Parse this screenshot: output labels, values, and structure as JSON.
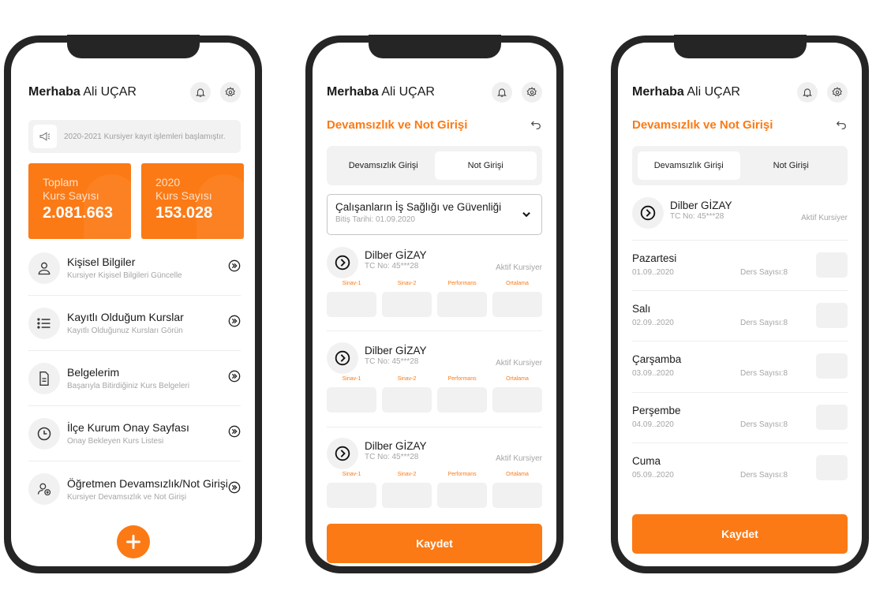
{
  "user": {
    "greeting": "Merhaba",
    "name": "Ali UÇAR"
  },
  "colors": {
    "accent": "#fb7a15",
    "frame": "#252525"
  },
  "screen1": {
    "announcement": "2020-2021 Kursiyer kayıt işlemleri başlamıştır.",
    "stats": [
      {
        "line1": "Toplam",
        "line2": "Kurs Sayısı",
        "value": "2.081.663"
      },
      {
        "line1": "2020",
        "line2": "Kurs Sayısı",
        "value": "153.028"
      }
    ],
    "menu": [
      {
        "icon": "user-icon",
        "title": "Kişisel Bilgiler",
        "subtitle": "Kursiyer Kişisel Bilgileri Güncelle"
      },
      {
        "icon": "list-icon",
        "title": "Kayıtlı Olduğum Kurslar",
        "subtitle": "Kayıtlı Olduğunuz Kursları Görün"
      },
      {
        "icon": "document-icon",
        "title": "Belgelerim",
        "subtitle": "Başarıyla Bitirdiğiniz Kurs Belgeleri"
      },
      {
        "icon": "clock-icon",
        "title": "İlçe Kurum Onay Sayfası",
        "subtitle": "Onay Bekleyen Kurs Listesi"
      },
      {
        "icon": "user-add-icon",
        "title": "Öğretmen Devamsızlık/Not Girişi",
        "subtitle": "Kursiyer Devamsızlık ve Not Girişi"
      }
    ]
  },
  "screen2": {
    "title": "Devamsızlık ve Not Girişi",
    "tabs": [
      "Devamsızlık Girişi",
      "Not Girişi"
    ],
    "active_tab": 1,
    "course": {
      "name": "Çalışanların İş Sağlığı ve Güvenliği",
      "end_date": "Bitiş Tarihi: 01.09.2020"
    },
    "grade_labels": [
      "Sinav-1",
      "Sinav-2",
      "Performans",
      "Ortalama"
    ],
    "students": [
      {
        "name": "Dilber GİZAY",
        "tc": "TC No: 45***28",
        "status": "Aktif Kursiyer"
      },
      {
        "name": "Dilber GİZAY",
        "tc": "TC No: 45***28",
        "status": "Aktif Kursiyer"
      },
      {
        "name": "Dilber GİZAY",
        "tc": "TC No: 45***28",
        "status": "Aktif Kursiyer"
      }
    ],
    "save_label": "Kaydet"
  },
  "screen3": {
    "title": "Devamsızlık ve Not Girişi",
    "tabs": [
      "Devamsızlık Girişi",
      "Not Girişi"
    ],
    "active_tab": 0,
    "student": {
      "name": "Dilber GİZAY",
      "tc": "TC No: 45***28",
      "status": "Aktif Kursiyer"
    },
    "days": [
      {
        "day": "Pazartesi",
        "date": "01.09..2020",
        "count": "Ders Sayısı:8"
      },
      {
        "day": "Salı",
        "date": "02.09..2020",
        "count": "Ders Sayısı:8"
      },
      {
        "day": "Çarşamba",
        "date": "03.09..2020",
        "count": "Ders Sayısı:8"
      },
      {
        "day": "Perşembe",
        "date": "04.09..2020",
        "count": "Ders Sayısı:8"
      },
      {
        "day": "Cuma",
        "date": "05.09..2020",
        "count": "Ders Sayısı:8"
      }
    ],
    "save_label": "Kaydet"
  }
}
